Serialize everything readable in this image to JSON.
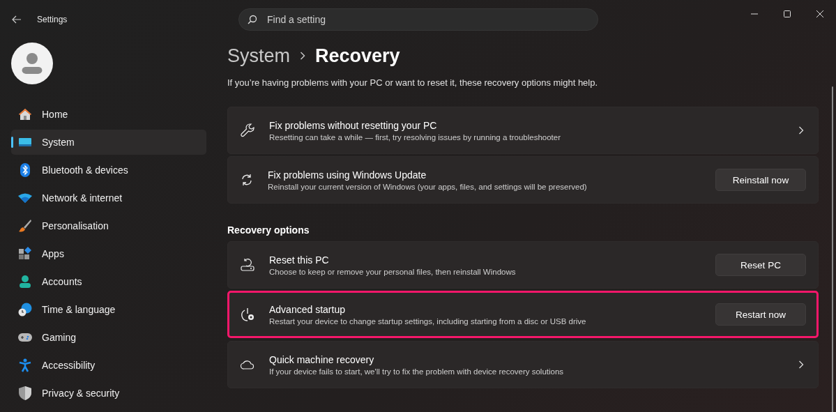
{
  "window": {
    "title": "Settings"
  },
  "search": {
    "placeholder": "Find a setting"
  },
  "sidebar": {
    "items": [
      {
        "label": "Home",
        "kind": "home",
        "selected": false
      },
      {
        "label": "System",
        "kind": "system",
        "selected": true
      },
      {
        "label": "Bluetooth & devices",
        "kind": "bluetooth",
        "selected": false
      },
      {
        "label": "Network & internet",
        "kind": "wifi",
        "selected": false
      },
      {
        "label": "Personalisation",
        "kind": "brush",
        "selected": false
      },
      {
        "label": "Apps",
        "kind": "apps",
        "selected": false
      },
      {
        "label": "Accounts",
        "kind": "person",
        "selected": false
      },
      {
        "label": "Time & language",
        "kind": "globe",
        "selected": false
      },
      {
        "label": "Gaming",
        "kind": "gamepad",
        "selected": false
      },
      {
        "label": "Accessibility",
        "kind": "access",
        "selected": false
      },
      {
        "label": "Privacy & security",
        "kind": "shield",
        "selected": false
      }
    ]
  },
  "breadcrumb": {
    "parent": "System",
    "current": "Recovery"
  },
  "description": "If you’re having problems with your PC or want to reset it, these recovery options might help.",
  "sections": [
    {
      "cards": [
        {
          "title": "Fix problems without resetting your PC",
          "subtitle": "Resetting can take a while — first, try resolving issues by running a troubleshooter",
          "kind": "link",
          "highlighted": false
        },
        {
          "title": "Fix problems using Windows Update",
          "subtitle": "Reinstall your current version of Windows (your apps, files, and settings will be preserved)",
          "kind": "button",
          "button": "Reinstall now",
          "highlighted": false
        }
      ]
    },
    {
      "heading": "Recovery options",
      "cards": [
        {
          "title": "Reset this PC",
          "subtitle": "Choose to keep or remove your personal files, then reinstall Windows",
          "kind": "button",
          "button": "Reset PC",
          "highlighted": false
        },
        {
          "title": "Advanced startup",
          "subtitle": "Restart your device to change startup settings, including starting from a disc or USB drive",
          "kind": "button",
          "button": "Restart now",
          "highlighted": true
        },
        {
          "title": "Quick machine recovery",
          "subtitle": "If your device fails to start, we'll try to fix the problem with device recovery solutions",
          "kind": "link",
          "highlighted": false
        }
      ]
    }
  ]
}
